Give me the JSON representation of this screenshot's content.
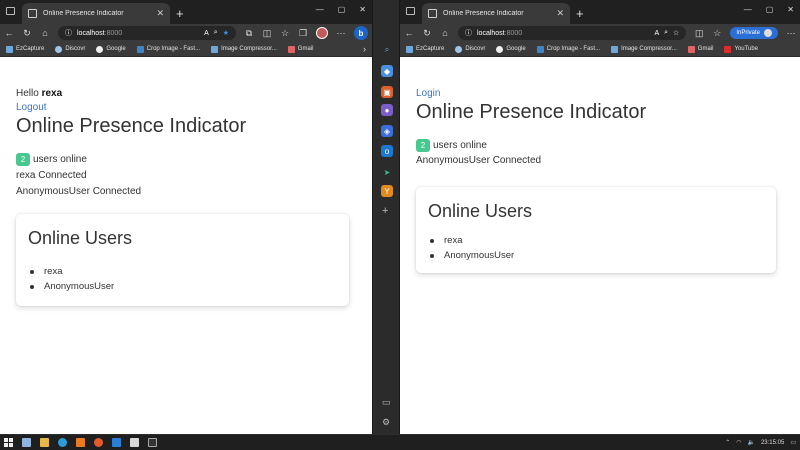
{
  "left_window": {
    "tab_title": "Online Presence Indicator",
    "address_host": "localhost",
    "address_port": ":8000",
    "bookmarks": [
      "EzCapture",
      "Discovr",
      "Google",
      "Crop Image - Fast...",
      "Image Compressor...",
      "Gmail"
    ],
    "page": {
      "hello_prefix": "Hello",
      "username": "rexa",
      "logout_label": "Logout",
      "title": "Online Presence Indicator",
      "online_count": "2",
      "online_suffix": "users online",
      "log_lines": [
        "rexa Connected",
        "AnonymousUser Connected"
      ],
      "card_title": "Online Users",
      "users": [
        "rexa",
        "AnonymousUser"
      ]
    }
  },
  "right_window": {
    "tab_title": "Online Presence Indicator",
    "address_host": "localhost",
    "address_port": ":8000",
    "inprivate_label": "InPrivate",
    "bookmarks": [
      "EzCapture",
      "Discovr",
      "Google",
      "Crop Image - Fast...",
      "Image Compressor...",
      "Gmail",
      "YouTube"
    ],
    "page": {
      "login_label": "Login",
      "title": "Online Presence Indicator",
      "online_count": "2",
      "online_suffix": "users online",
      "log_lines": [
        "AnonymousUser Connected"
      ],
      "card_title": "Online Users",
      "users": [
        "rexa",
        "AnonymousUser"
      ]
    }
  },
  "sidepanel_icons": [
    "search-icon",
    "tag-icon",
    "briefcase-icon",
    "people-icon",
    "office-icon",
    "outlook-icon",
    "send-icon",
    "y-icon"
  ],
  "taskbar": {
    "time": "23:15:05"
  },
  "colors": {
    "badge": "#48c78e",
    "link": "#3a74c4",
    "accent": "#2a6fd6"
  }
}
